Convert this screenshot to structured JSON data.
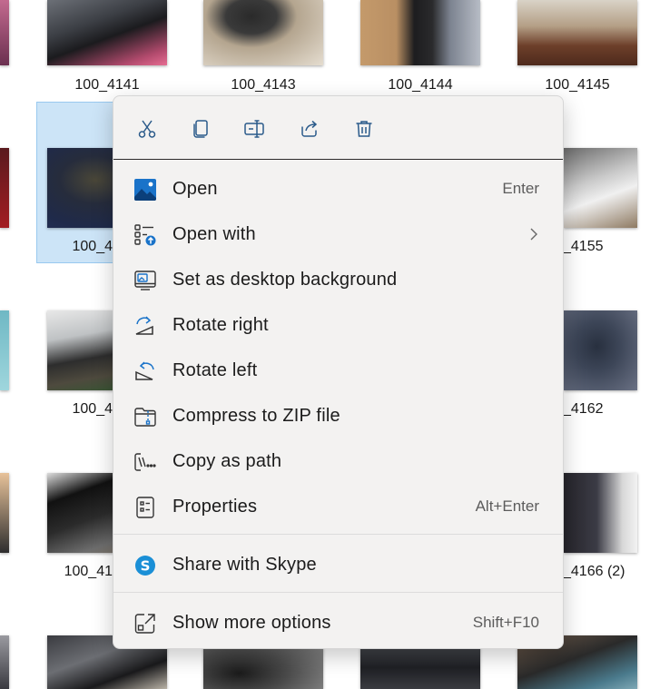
{
  "files": [
    {
      "name": "100_4141"
    },
    {
      "name": "100_4143"
    },
    {
      "name": "100_4144"
    },
    {
      "name": "100_4145"
    },
    {
      "name": "100_4"
    },
    {
      "name": "_4155"
    },
    {
      "name": "100_4"
    },
    {
      "name": "_4162"
    },
    {
      "name": "100_41"
    },
    {
      "name": "_4166 (2)"
    }
  ],
  "context_menu": {
    "toolbar": [
      {
        "icon": "cut-icon"
      },
      {
        "icon": "copy-icon"
      },
      {
        "icon": "rename-icon"
      },
      {
        "icon": "share-icon"
      },
      {
        "icon": "delete-icon"
      }
    ],
    "items": [
      {
        "label": "Open",
        "accel": "Enter",
        "icon": "image-icon"
      },
      {
        "label": "Open with",
        "icon": "open-with-icon"
      },
      {
        "label": "Set as desktop background",
        "icon": "desktop-background-icon"
      },
      {
        "label": "Rotate right",
        "icon": "rotate-right-icon"
      },
      {
        "label": "Rotate left",
        "icon": "rotate-left-icon"
      },
      {
        "label": "Compress to ZIP file",
        "icon": "zip-folder-icon"
      },
      {
        "label": "Copy as path",
        "icon": "copy-path-icon"
      },
      {
        "label": "Properties",
        "accel": "Alt+Enter",
        "icon": "properties-icon"
      },
      {
        "label": "Share with Skype",
        "icon": "skype-icon"
      },
      {
        "label": "Show more options",
        "accel": "Shift+F10",
        "icon": "more-options-icon"
      }
    ]
  },
  "colors": {
    "accent": "#0067c0",
    "selection": "#cce4f7",
    "menu_bg": "#f3f2f1"
  }
}
